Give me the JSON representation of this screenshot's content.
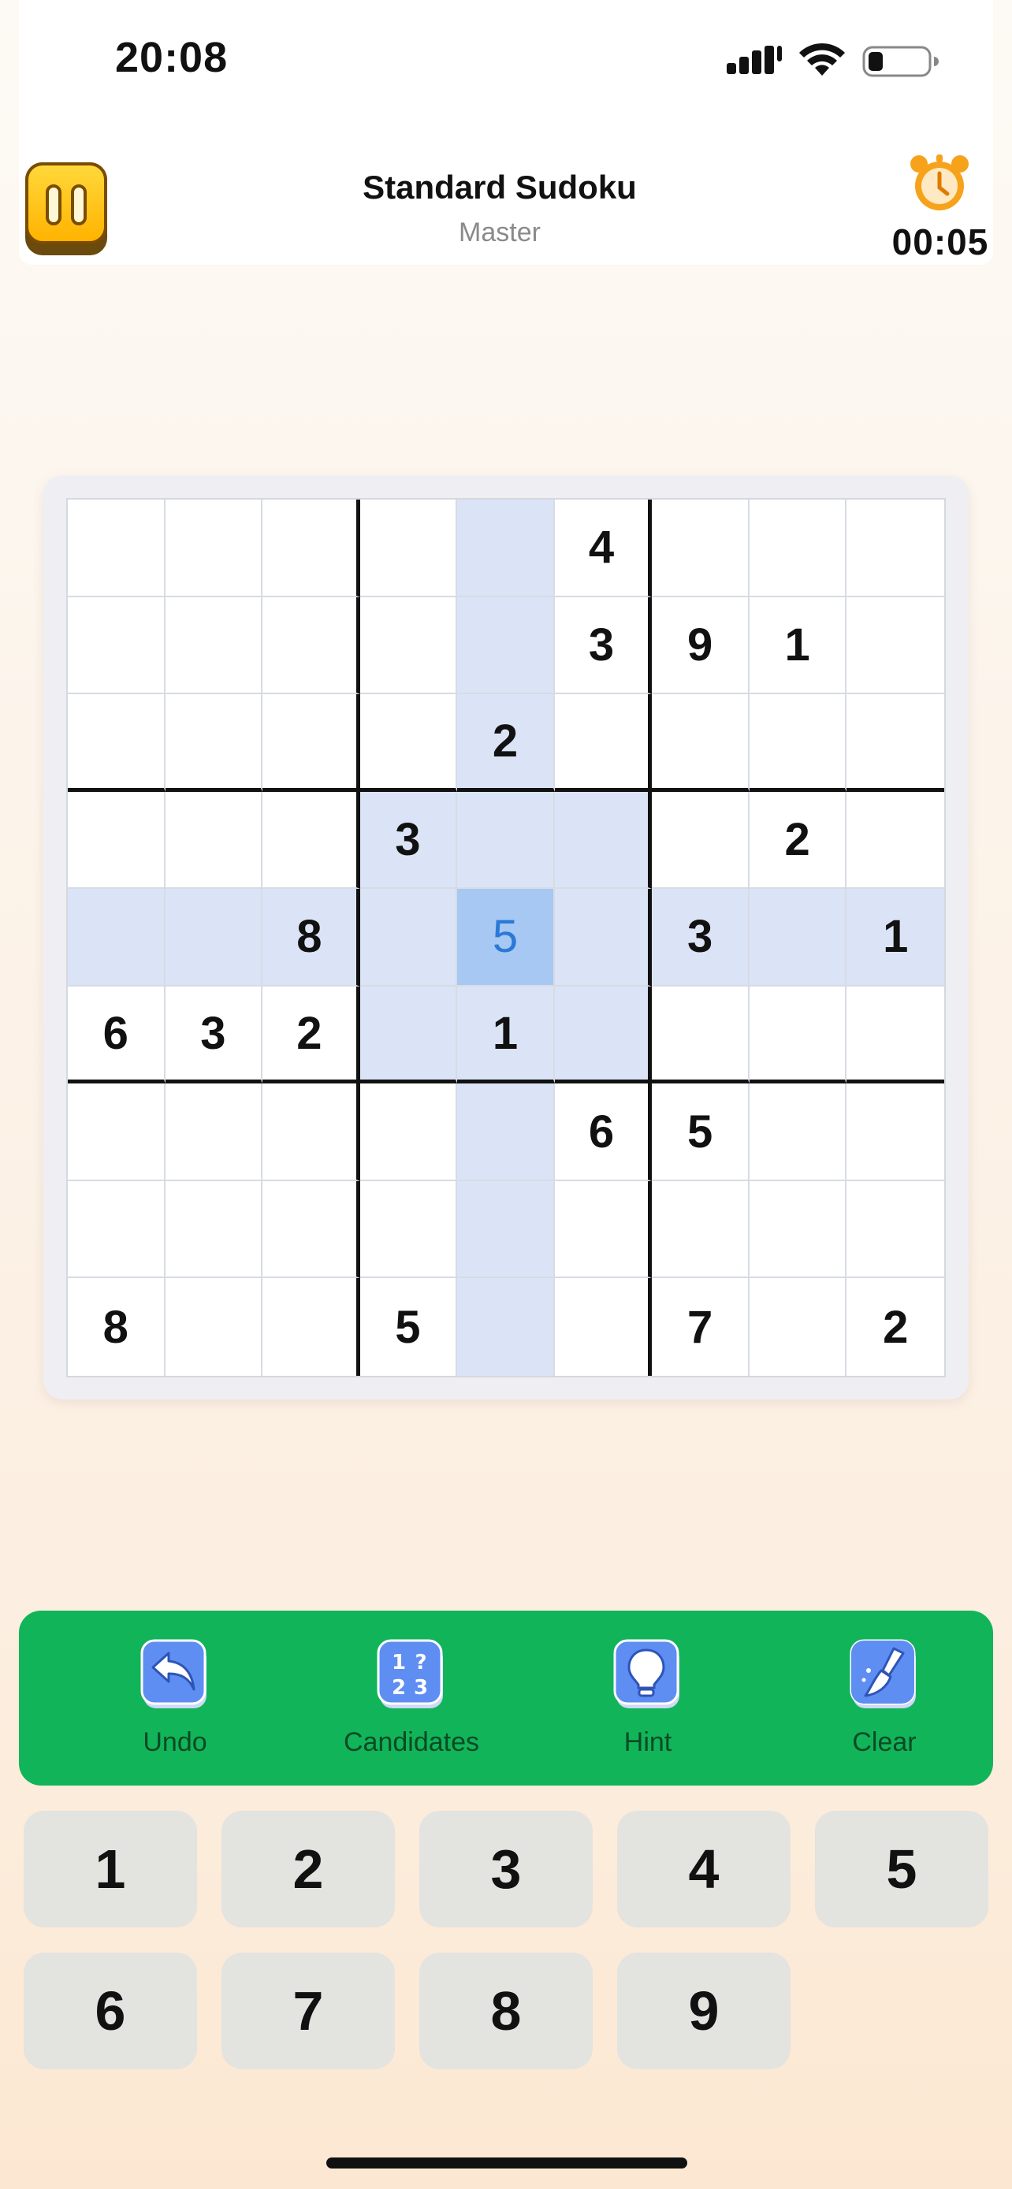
{
  "status_bar": {
    "time": "20:08",
    "icons": [
      "cellular-signal-icon",
      "wifi-icon",
      "battery-icon"
    ]
  },
  "header": {
    "title": "Standard Sudoku",
    "difficulty": "Master",
    "timer": "00:05",
    "pause_icon": "pause-icon",
    "timer_icon": "alarm-clock-icon"
  },
  "board": {
    "rows": [
      [
        "",
        "",
        "",
        "",
        "",
        "4",
        "",
        "",
        ""
      ],
      [
        "",
        "",
        "",
        "",
        "",
        "3",
        "9",
        "1",
        ""
      ],
      [
        "",
        "",
        "",
        "",
        "2",
        "",
        "",
        "",
        ""
      ],
      [
        "",
        "",
        "",
        "3",
        "",
        "",
        "",
        "2",
        ""
      ],
      [
        "",
        "",
        "8",
        "",
        "5",
        "",
        "3",
        "",
        "1"
      ],
      [
        "6",
        "3",
        "2",
        "",
        "1",
        "",
        "",
        "",
        ""
      ],
      [
        "",
        "",
        "",
        "",
        "",
        "6",
        "5",
        "",
        ""
      ],
      [
        "",
        "",
        "",
        "",
        "",
        "",
        "",
        "",
        ""
      ],
      [
        "8",
        "",
        "",
        "5",
        "",
        "",
        "7",
        "",
        "2"
      ]
    ],
    "selected_row": 4,
    "selected_col": 4,
    "user_entered": [
      [
        4,
        4
      ]
    ],
    "colors": {
      "highlight": "#dbe4f6",
      "selected": "#a6c8f2",
      "entered_digit": "#2b79d6"
    }
  },
  "tools": [
    {
      "label": "Undo",
      "icon": "undo-arrow-icon"
    },
    {
      "label": "Candidates",
      "icon": "candidates-notes-icon"
    },
    {
      "label": "Hint",
      "icon": "lightbulb-icon"
    },
    {
      "label": "Clear",
      "icon": "eraser-broom-icon"
    }
  ],
  "toolbar_color": "#12b45a",
  "keypad": [
    "1",
    "2",
    "3",
    "4",
    "5",
    "6",
    "7",
    "8",
    "9"
  ]
}
